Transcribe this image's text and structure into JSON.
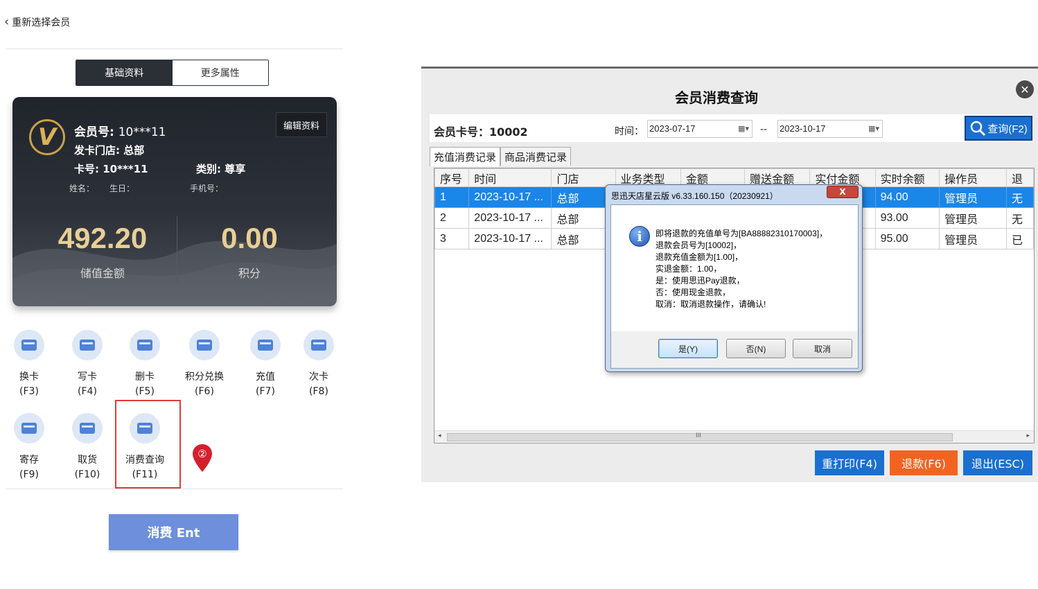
{
  "left": {
    "back_label": "重新选择会员",
    "tabs": [
      {
        "label": "基础资料",
        "active": true
      },
      {
        "label": "更多属性",
        "active": false
      }
    ],
    "card": {
      "member_no_label": "会员号:",
      "member_no": "10***11",
      "store_line": "发卡门店: 总部",
      "card_no_line": "卡号: 10***11",
      "category_line": "类别: 尊享",
      "name_label": "姓名：",
      "birthday_label": "生日：",
      "phone_label": "手机号：",
      "edit_label": "编辑资料",
      "balance": "492.20",
      "balance_label": "储值金额",
      "points": "0.00",
      "points_label": "积分",
      "logo_letter": "V"
    },
    "functions": [
      {
        "label": "换卡",
        "key": "(F3)"
      },
      {
        "label": "写卡",
        "key": "(F4)"
      },
      {
        "label": "删卡",
        "key": "(F5)"
      },
      {
        "label": "积分兑换",
        "key": "(F6)"
      },
      {
        "label": "充值",
        "key": "(F7)"
      },
      {
        "label": "次卡",
        "key": "(F8)"
      },
      {
        "label": "寄存",
        "key": "(F9)"
      },
      {
        "label": "取货",
        "key": "(F10)"
      },
      {
        "label": "消费查询",
        "key": "(F11)"
      }
    ],
    "marker_number": "②",
    "consume_label": "消费 Ent",
    "accent_blue": "#6d8fdc",
    "highlight_color": "#e03a3a"
  },
  "window": {
    "title": "会员消费查询",
    "close_glyph": "✕",
    "card_no": "会员卡号：10002",
    "time_label": "时间：",
    "date_from": "2023-07-17",
    "date_to": "2023-10-17",
    "date_sep": "--",
    "query_label": "查询(F2)",
    "tabs": [
      {
        "label": "充值消费记录",
        "active": true
      },
      {
        "label": "商品消费记录",
        "active": false
      }
    ],
    "columns": [
      "序号",
      "时间",
      "门店",
      "业务类型",
      "金额",
      "赠送金额",
      "实付金额",
      "实时余额",
      "操作员",
      "退"
    ],
    "rows": [
      [
        "1",
        "2023-10-17 ...",
        "总部",
        "",
        "",
        "",
        "",
        "94.00",
        "管理员",
        "无"
      ],
      [
        "2",
        "2023-10-17 ...",
        "总部",
        "",
        "",
        "",
        "",
        "93.00",
        "管理员",
        "无"
      ],
      [
        "3",
        "2023-10-17 ...",
        "总部",
        "",
        "",
        "",
        "",
        "95.00",
        "管理员",
        "已"
      ]
    ],
    "scroll_mark": "III",
    "buttons": {
      "reprint": {
        "label": "重打印(F4)",
        "color": "#1a6fd1"
      },
      "refund": {
        "label": "退款(F6)",
        "color": "#f26322"
      },
      "exit": {
        "label": "退出(ESC)",
        "color": "#1a6fd1"
      }
    }
  },
  "dialog": {
    "title": "思迅天店星云版 v6.33.160.150（20230921）",
    "close_glyph": "X",
    "lines": [
      "即将退款的充值单号为[BA88882310170003]，",
      "退款会员号为[10002]，",
      "退款充值金额为[1.00]，",
      "实退金额：1.00，",
      "是：使用思迅Pay退款，",
      "否：使用现金退款，",
      "取消：取消退款操作，请确认!"
    ],
    "yes_label": "是(Y)",
    "no_label": "否(N)",
    "cancel_label": "取消"
  }
}
